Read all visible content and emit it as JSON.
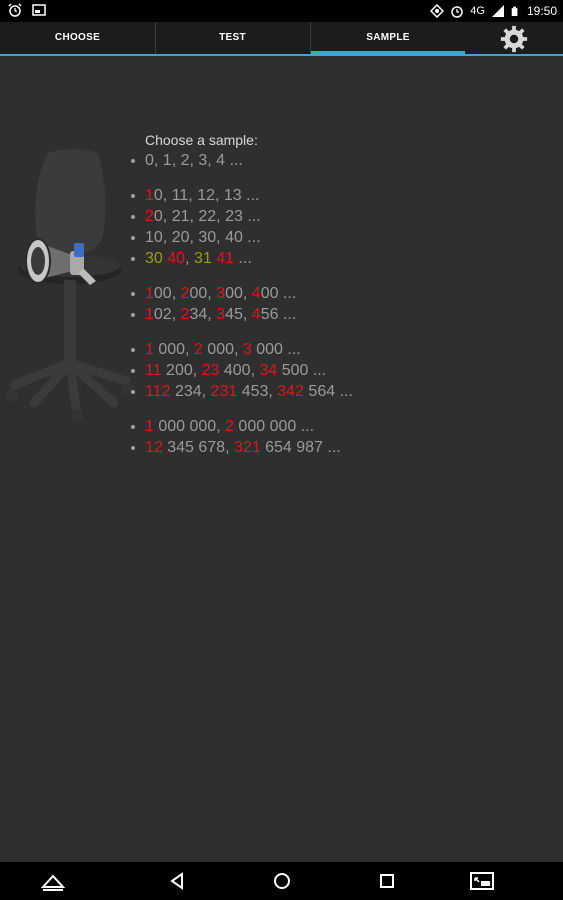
{
  "status_bar": {
    "network": "4G",
    "time": "19:50",
    "icons": [
      "alarm-icon",
      "screenshot-icon",
      "data-saver-icon",
      "alarm-icon",
      "signal-icon",
      "battery-icon"
    ]
  },
  "tabs": [
    {
      "label": "CHOOSE",
      "active": false
    },
    {
      "label": "TEST",
      "active": false
    },
    {
      "label": "SAMPLE",
      "active": true
    }
  ],
  "settings_icon": "gear-icon",
  "illustration": "chair-with-megaphone-icon",
  "heading": "Choose a sample:",
  "colors": {
    "accent": "#3aa6d6",
    "highlight_red": "#e0151b",
    "highlight_olive": "#9c9a14",
    "text_gray": "#9a9a9a"
  },
  "groups": [
    {
      "items": [
        {
          "parts": [
            {
              "t": "0, 1, 2, 3, 4 ...",
              "c": "gray"
            }
          ]
        }
      ]
    },
    {
      "items": [
        {
          "parts": [
            {
              "t": "1",
              "c": "red"
            },
            {
              "t": "0, 11, 12, 13 ...",
              "c": "gray"
            }
          ]
        },
        {
          "parts": [
            {
              "t": "2",
              "c": "red"
            },
            {
              "t": "0, 21, 22, 23 ...",
              "c": "gray"
            }
          ]
        },
        {
          "parts": [
            {
              "t": "10, 20, 30, 40 ...",
              "c": "gray"
            }
          ]
        },
        {
          "parts": [
            {
              "t": "30",
              "c": "olive"
            },
            {
              "t": " ",
              "c": "gray"
            },
            {
              "t": "40",
              "c": "red"
            },
            {
              "t": ", ",
              "c": "gray"
            },
            {
              "t": "31",
              "c": "olive"
            },
            {
              "t": " ",
              "c": "gray"
            },
            {
              "t": "41",
              "c": "red"
            },
            {
              "t": " ...",
              "c": "gray"
            }
          ]
        }
      ]
    },
    {
      "items": [
        {
          "parts": [
            {
              "t": "1",
              "c": "red"
            },
            {
              "t": "00, ",
              "c": "gray"
            },
            {
              "t": "2",
              "c": "red"
            },
            {
              "t": "00, ",
              "c": "gray"
            },
            {
              "t": "3",
              "c": "red"
            },
            {
              "t": "00, ",
              "c": "gray"
            },
            {
              "t": "4",
              "c": "red"
            },
            {
              "t": "00 ...",
              "c": "gray"
            }
          ]
        },
        {
          "parts": [
            {
              "t": "1",
              "c": "red"
            },
            {
              "t": "02, ",
              "c": "gray"
            },
            {
              "t": "2",
              "c": "red"
            },
            {
              "t": "34, ",
              "c": "gray"
            },
            {
              "t": "3",
              "c": "red"
            },
            {
              "t": "45, ",
              "c": "gray"
            },
            {
              "t": "4",
              "c": "red"
            },
            {
              "t": "56 ...",
              "c": "gray"
            }
          ]
        }
      ]
    },
    {
      "items": [
        {
          "parts": [
            {
              "t": "1",
              "c": "red"
            },
            {
              "t": " 000, ",
              "c": "gray"
            },
            {
              "t": "2",
              "c": "red"
            },
            {
              "t": " 000, ",
              "c": "gray"
            },
            {
              "t": "3",
              "c": "red"
            },
            {
              "t": " 000 ...",
              "c": "gray"
            }
          ]
        },
        {
          "parts": [
            {
              "t": "11",
              "c": "red"
            },
            {
              "t": " 200, ",
              "c": "gray"
            },
            {
              "t": "23",
              "c": "red"
            },
            {
              "t": " 400, ",
              "c": "gray"
            },
            {
              "t": "34",
              "c": "red"
            },
            {
              "t": " 500 ...",
              "c": "gray"
            }
          ]
        },
        {
          "parts": [
            {
              "t": "112",
              "c": "red"
            },
            {
              "t": " 234, ",
              "c": "gray"
            },
            {
              "t": "231",
              "c": "red"
            },
            {
              "t": " 453, ",
              "c": "gray"
            },
            {
              "t": "342",
              "c": "red"
            },
            {
              "t": " 564 ...",
              "c": "gray"
            }
          ]
        }
      ]
    },
    {
      "items": [
        {
          "parts": [
            {
              "t": "1",
              "c": "red"
            },
            {
              "t": " 000 000, ",
              "c": "gray"
            },
            {
              "t": "2",
              "c": "red"
            },
            {
              "t": " 000 000 ...",
              "c": "gray"
            }
          ]
        },
        {
          "parts": [
            {
              "t": "12",
              "c": "red"
            },
            {
              "t": " 345 678, ",
              "c": "gray"
            },
            {
              "t": "321",
              "c": "red"
            },
            {
              "t": " 654 987 ...",
              "c": "gray"
            }
          ]
        }
      ]
    }
  ],
  "nav_bar": [
    "menu-up-icon",
    "back-icon",
    "home-icon",
    "recents-icon",
    "screen-mirror-icon"
  ]
}
